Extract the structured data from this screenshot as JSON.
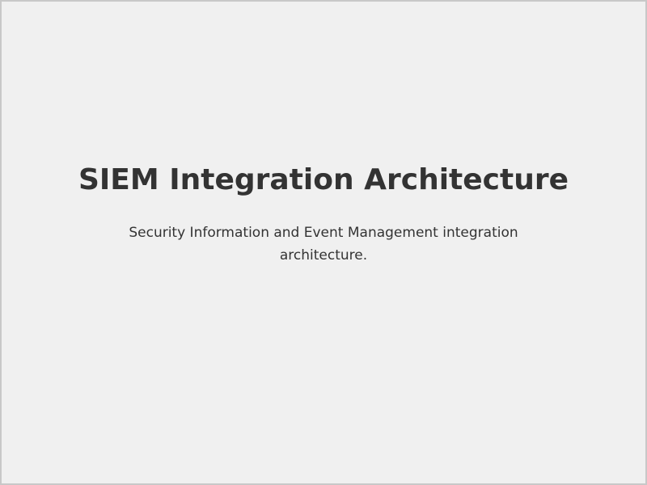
{
  "page": {
    "title": "SIEM Integration Architecture",
    "description": "Security Information and Event Management integration architecture."
  },
  "colors": {
    "background": "#f0f0f0",
    "border": "#c8c8c8",
    "text": "#333333"
  }
}
